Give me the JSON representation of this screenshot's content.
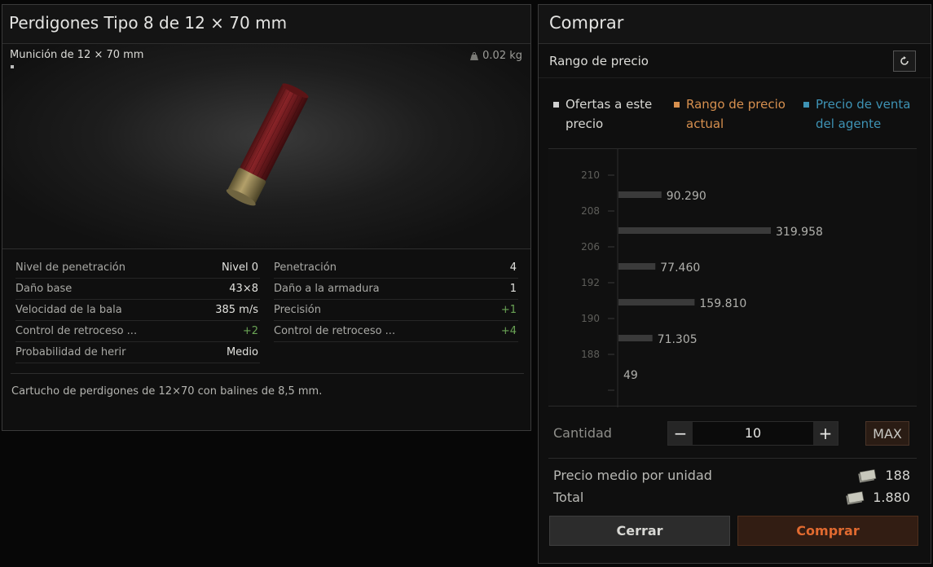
{
  "item": {
    "title": "Perdigones Tipo 8 de 12 × 70 mm",
    "ammo_type": "Munición de 12 × 70 mm",
    "weight": "0.02 kg",
    "stats_left": [
      {
        "label": "Nivel de penetración",
        "value": "Nivel 0",
        "tone": "normal"
      },
      {
        "label": "Daño base",
        "value": "43×8",
        "tone": "normal"
      },
      {
        "label": "Velocidad de la bala",
        "value": "385 m/s",
        "tone": "normal"
      },
      {
        "label": "Control de retroceso ...",
        "value": "+2",
        "tone": "positive"
      },
      {
        "label": "Probabilidad de herir",
        "value": "Medio",
        "tone": "normal"
      }
    ],
    "stats_right": [
      {
        "label": "Penetración",
        "value": "4",
        "tone": "normal"
      },
      {
        "label": "Daño a la armadura",
        "value": "1",
        "tone": "normal"
      },
      {
        "label": "Precisión",
        "value": "+1",
        "tone": "positive"
      },
      {
        "label": "Control de retroceso ...",
        "value": "+4",
        "tone": "positive"
      }
    ],
    "description": "Cartucho de perdigones de 12×70 con balines de 8,5 mm."
  },
  "buy": {
    "title": "Comprar",
    "range_label": "Rango de precio",
    "legend": [
      {
        "line1": "Ofertas a este",
        "line2": "precio",
        "color": "#d0d0d0",
        "text_color": "#d8d8d4"
      },
      {
        "line1": "Rango de precio",
        "line2": "actual",
        "color": "#d7904f",
        "text_color": "#d7904f"
      },
      {
        "line1": "Precio de venta",
        "line2": "del agente",
        "color": "#3e93b5",
        "text_color": "#3e93b5"
      }
    ],
    "quantity_label": "Cantidad",
    "quantity_value": "10",
    "max_label": "MAX",
    "avg_label": "Precio medio por unidad",
    "avg_value": "188",
    "total_label": "Total",
    "total_value": "1.880",
    "close_label": "Cerrar",
    "buy_label": "Comprar"
  },
  "colors": {
    "bar": "#3a3a3a",
    "positive": "#6aa455",
    "buy_button_text": "#e06a30"
  },
  "chart_data": {
    "type": "bar",
    "orientation": "horizontal",
    "categories": [
      "210",
      "208",
      "206",
      "192",
      "190",
      "188"
    ],
    "values": [
      90290,
      319958,
      77460,
      159810,
      71305,
      49
    ],
    "data_labels": [
      "90.290",
      "319.958",
      "77.460",
      "159.810",
      "71.305",
      "49"
    ],
    "xlim": [
      0,
      319958
    ]
  }
}
